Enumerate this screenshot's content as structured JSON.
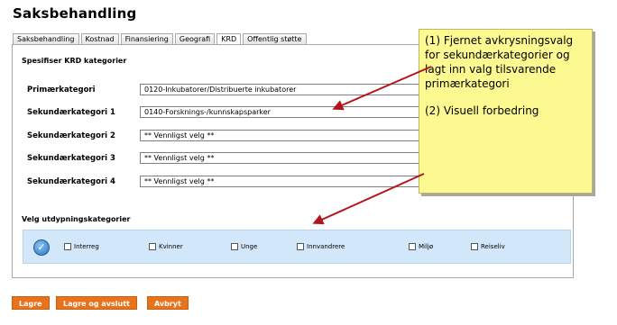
{
  "page": {
    "title": "Saksbehandling"
  },
  "tabs": [
    {
      "label": "Saksbehandling",
      "active": false
    },
    {
      "label": "Kostnad",
      "active": false
    },
    {
      "label": "Finansiering",
      "active": false
    },
    {
      "label": "Geografi",
      "active": false
    },
    {
      "label": "KRD",
      "active": true
    },
    {
      "label": "Offentlig støtte",
      "active": false
    }
  ],
  "krd": {
    "section_title": "Spesifiser KRD kategorier",
    "rows": [
      {
        "label": "Primærkategori",
        "value": "0120-Inkubatorer/Distribuerte inkubatorer"
      },
      {
        "label": "Sekundærkategori 1",
        "value": "0140-Forsknings-/kunnskapsparker"
      },
      {
        "label": "Sekundærkategori 2",
        "value": "** Vennligst velg **"
      },
      {
        "label": "Sekundærkategori 3",
        "value": "** Vennligst velg **"
      },
      {
        "label": "Sekundærkategori 4",
        "value": "** Vennligst velg **"
      }
    ]
  },
  "utdypning": {
    "section_title": "Velg utdypningskategorier",
    "options": [
      {
        "label": "Interreg",
        "checked": false
      },
      {
        "label": "Kvinner",
        "checked": false
      },
      {
        "label": "Unge",
        "checked": false
      },
      {
        "label": "Innvandrere",
        "checked": false
      },
      {
        "label": "Miljø",
        "checked": false
      },
      {
        "label": "Reiseliv",
        "checked": false
      }
    ]
  },
  "buttons": {
    "save": "Lagre",
    "save_close": "Lagre og avslutt",
    "cancel": "Avbryt"
  },
  "annotation": {
    "note1": "(1) Fjernet avkrysningsvalg for sekundærkategorier og lagt inn valg tilsvarende primærkategori",
    "note2": "(2) Visuell forbedring"
  },
  "colors": {
    "accent_button": "#e8731c",
    "check_band": "#d2e7f9",
    "note": "#fbf98f",
    "arrow": "#b2161b"
  },
  "icons": {
    "dropdown": "triangle-down-icon",
    "check": "check-circle-icon"
  }
}
